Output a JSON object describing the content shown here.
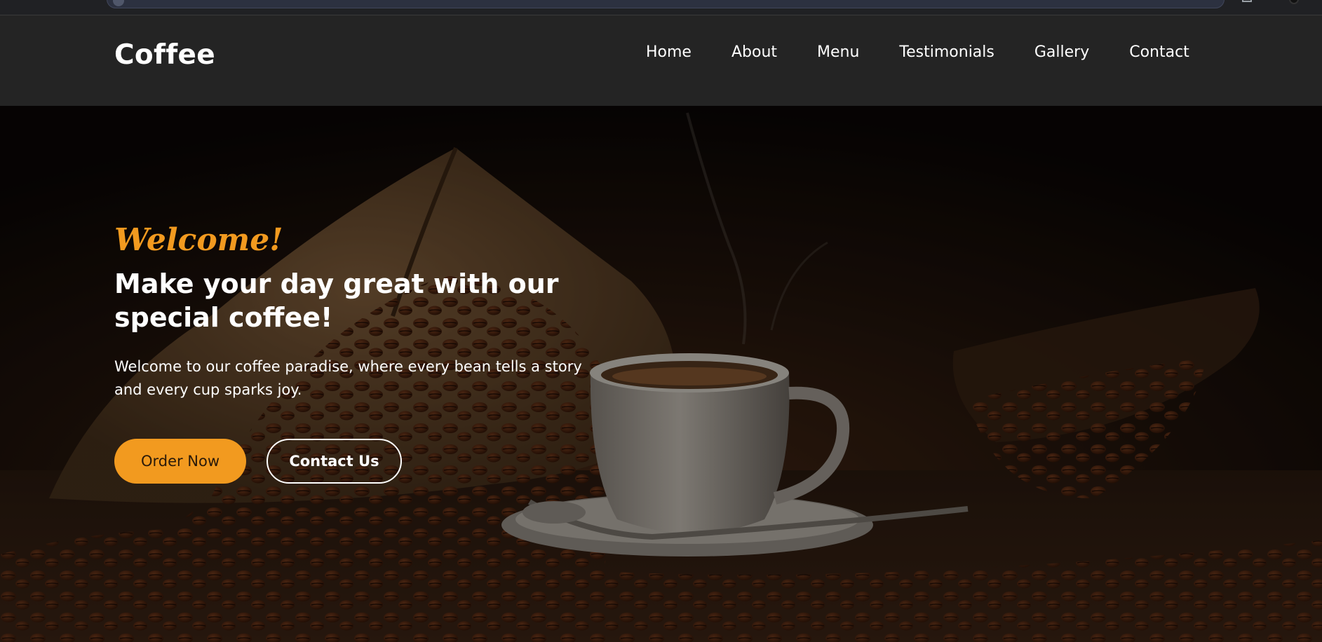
{
  "brand": {
    "name": "Coffee"
  },
  "nav": {
    "items": [
      {
        "label": "Home"
      },
      {
        "label": "About"
      },
      {
        "label": "Menu"
      },
      {
        "label": "Testimonials"
      },
      {
        "label": "Gallery"
      },
      {
        "label": "Contact"
      }
    ]
  },
  "hero": {
    "welcome": "Welcome!",
    "headline": "Make your day great with our special coffee!",
    "subtext": "Welcome to our coffee paradise, where every bean tells a story and every cup sparks joy.",
    "primary_button": "Order Now",
    "secondary_button": "Contact Us",
    "background_image_icon": "coffee-cup-and-beans-photo"
  },
  "colors": {
    "accent": "#f29a1f",
    "header_bg": "#242424",
    "text": "#ffffff"
  }
}
